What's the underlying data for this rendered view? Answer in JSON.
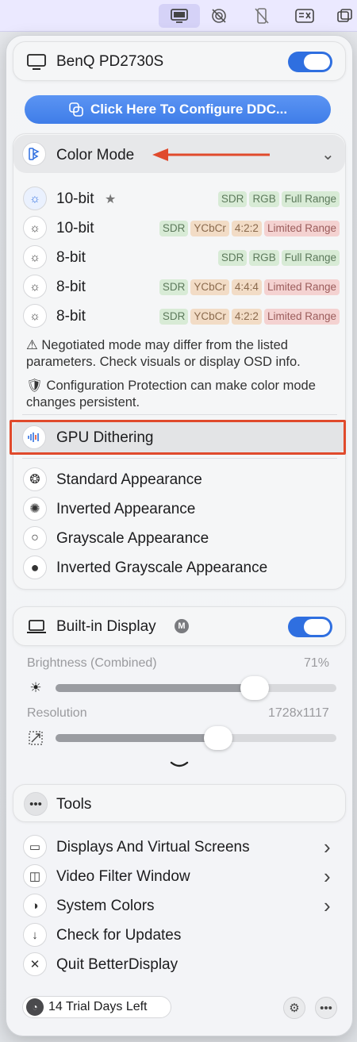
{
  "menubar": {
    "icons": [
      "display-icon",
      "no-touch-icon",
      "no-phone-icon",
      "screen-x-icon",
      "windows-icon"
    ]
  },
  "display1": {
    "name": "BenQ PD2730S",
    "toggle_on": true,
    "configure_button": "Click Here To Configure DDC..."
  },
  "color_mode": {
    "header": "Color Mode",
    "modes": [
      {
        "label": "10-bit",
        "starred": true,
        "tags": [
          [
            "SDR",
            "green"
          ],
          [
            "RGB",
            "green"
          ],
          [
            "Full Range",
            "green"
          ]
        ]
      },
      {
        "label": "10-bit",
        "starred": false,
        "tags": [
          [
            "SDR",
            "green"
          ],
          [
            "YCbCr",
            "orange"
          ],
          [
            "4:2:2",
            "orange"
          ],
          [
            "Limited Range",
            "red"
          ]
        ]
      },
      {
        "label": "8-bit",
        "starred": false,
        "tags": [
          [
            "SDR",
            "green"
          ],
          [
            "RGB",
            "green"
          ],
          [
            "Full Range",
            "green"
          ]
        ]
      },
      {
        "label": "8-bit",
        "starred": false,
        "tags": [
          [
            "SDR",
            "green"
          ],
          [
            "YCbCr",
            "orange"
          ],
          [
            "4:4:4",
            "orange"
          ],
          [
            "Limited Range",
            "red"
          ]
        ]
      },
      {
        "label": "8-bit",
        "starred": false,
        "tags": [
          [
            "SDR",
            "green"
          ],
          [
            "YCbCr",
            "orange"
          ],
          [
            "4:2:2",
            "orange"
          ],
          [
            "Limited Range",
            "red"
          ]
        ]
      }
    ],
    "note1": "⚠ Negotiated mode may differ from the listed parameters. Check visuals or display OSD info.",
    "note2": "🛡 Configuration Protection can make color mode changes persistent."
  },
  "gpu_dithering": "GPU Dithering",
  "appearances": [
    "Standard Appearance",
    "Inverted Appearance",
    "Grayscale Appearance",
    "Inverted Grayscale Appearance"
  ],
  "display2": {
    "name": "Built-in Display",
    "badge": "M",
    "toggle_on": true,
    "brightness_label": "Brightness (Combined)",
    "brightness_value": "71%",
    "brightness_fraction": 0.71,
    "resolution_label": "Resolution",
    "resolution_value": "1728x1117",
    "resolution_fraction": 0.58
  },
  "tools": {
    "header": "Tools",
    "items": [
      "Displays And Virtual Screens",
      "Video Filter Window",
      "System Colors",
      "Check for Updates",
      "Quit BetterDisplay"
    ]
  },
  "footer": {
    "trial": "14 Trial Days Left"
  },
  "colors": {
    "accent": "#2f6fe0",
    "annotation": "#e04a2c"
  }
}
